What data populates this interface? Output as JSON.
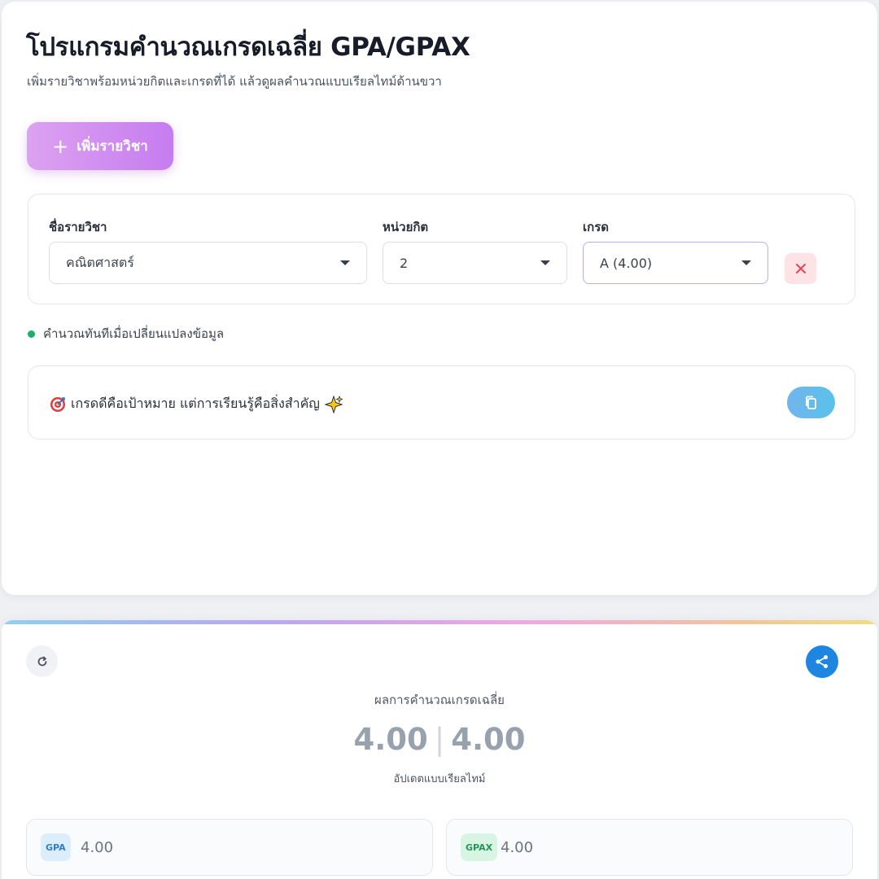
{
  "header": {
    "title": "โปรแกรมคำนวณเกรดเฉลี่ย GPA/GPAX",
    "subtitle": "เพิ่มรายวิชาพร้อมหน่วยกิตและเกรดที่ได้ แล้วดูผลคำนวณแบบเรียลไทม์ด้านขวา"
  },
  "add_button": {
    "icon": "plus-icon",
    "label": "เพิ่มรายวิชา"
  },
  "course": {
    "name_label": "ชื่อรายวิชา",
    "name_value": "คณิตศาสตร์",
    "credit_label": "หน่วยกิต",
    "credit_value": "2",
    "grade_label": "เกรด",
    "grade_value": "A (4.00)",
    "delete_icon": "close-icon"
  },
  "live_hint": "คำนวณทันทีเมื่อเปลี่ยนแปลงข้อมูล",
  "quote": {
    "text": "เกรดดีคือเป้าหมาย แต่การเรียนรู้คือสิ่งสำคัญ",
    "leading_icon": "target-icon",
    "trailing_icon": "sparkle-icon",
    "copy_icon": "copy-icon"
  },
  "result": {
    "title": "ผลการคำนวณเกรดเฉลี่ย",
    "gpa": "4.00",
    "separator": "|",
    "gpax": "4.00",
    "subtitle": "อัปเดตแบบเรียลไทม์",
    "gpa_badge": "GPA",
    "gpa_value": "4.00",
    "gpax_badge": "GPAX",
    "gpax_value": "4.00"
  },
  "colors": {
    "accent_purple": "#c67cf0",
    "live_green": "#1fae6a",
    "share_blue": "#1e86e0",
    "delete_red": "#e2475a"
  }
}
